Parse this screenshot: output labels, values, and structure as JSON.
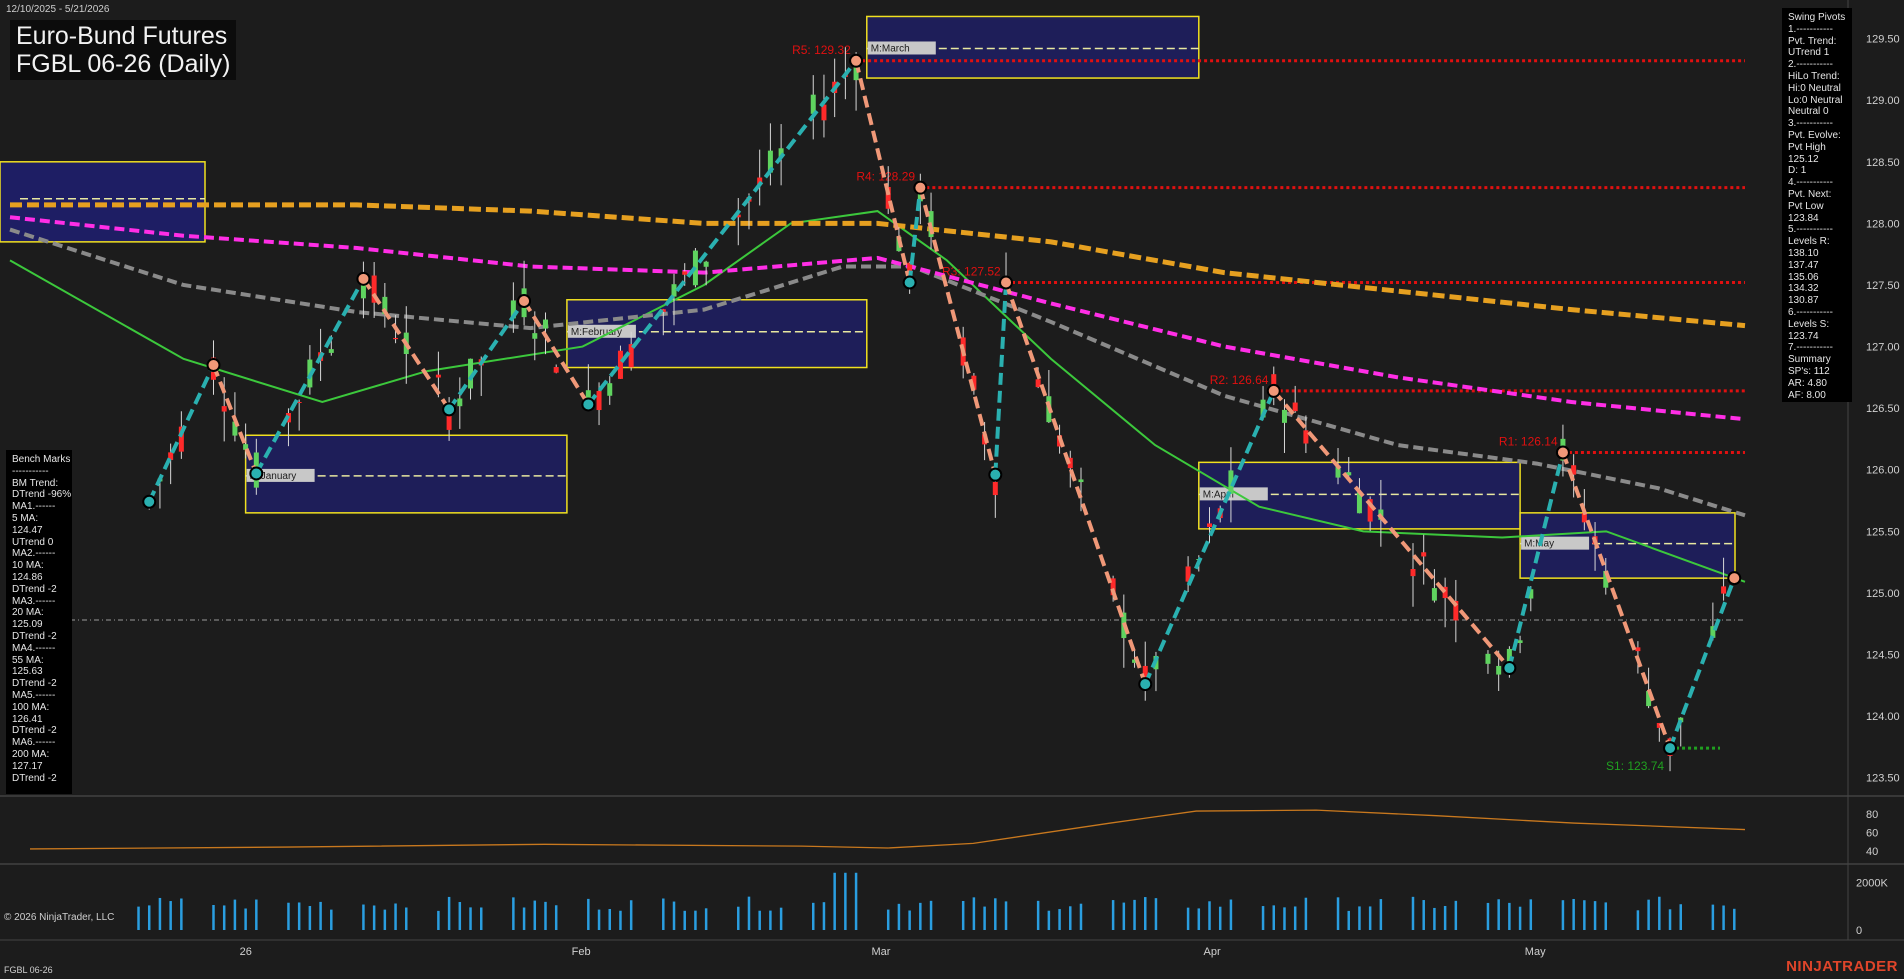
{
  "header": {
    "date_range": "12/10/2025 - 5/21/2026",
    "title_line1": "Euro-Bund Futures",
    "title_line2": "FGBL 06-26 (Daily)"
  },
  "footer": {
    "copyright": "© 2026 NinjaTrader, LLC",
    "symbol": "FGBL 06-26",
    "logo": "NINJATRADER"
  },
  "swing_pivots_panel": "Swing Pivots\n1.-----------\nPvt. Trend:\nUTrend 1\n2.-----------\nHiLo Trend:\nHi:0 Neutral\nLo:0 Neutral\nNeutral 0\n3.-----------\nPvt. Evolve:\nPvt High\n125.12\nD: 1\n4.-----------\nPvt. Next:\nPvt Low\n123.84\n5.-----------\nLevels R:\n138.10\n137.47\n135.06\n134.32\n130.87\n6.-----------\nLevels S:\n123.74\n7.-----------\nSummary\nSP's: 112\nAR: 4.80\nAF: 8.00",
  "bench_marks_panel": "Bench Marks\n-----------\nBM Trend:\nDTrend -96%\nMA1.------\n5 MA:\n124.47\nUTrend 0\nMA2.------\n10 MA:\n124.86\nDTrend -2\nMA3.------\n20 MA:\n125.09\nDTrend -2\nMA4.------\n55 MA:\n125.63\nDTrend -2\nMA5.------\n100 MA:\n126.41\nDTrend -2\nMA6.------\n200 MA:\n127.17\nDTrend -2",
  "colors": {
    "background": "#1c1c1c",
    "up_candle": "#5fd35f",
    "down_candle": "#ff2a2a",
    "ma_green": "#3cc83c",
    "ma_gray": "#8a8a8a",
    "ma_magenta": "#ff2ee6",
    "ma_orange": "#e6a020",
    "zone_fill": "#1e1e64",
    "zone_border": "#f0e020",
    "swing_up": "#2ab0b0",
    "swing_down": "#f09878",
    "resistance": "#e01010",
    "support": "#20a020"
  },
  "chart_data": {
    "type": "candlestick",
    "price_axis": {
      "range": [
        123.4,
        129.7
      ],
      "ticks": [
        "129.50",
        "129.00",
        "128.50",
        "128.00",
        "127.50",
        "127.00",
        "126.50",
        "126.00",
        "125.50",
        "125.00",
        "124.50",
        "124.00",
        "123.50"
      ],
      "last_price": 124.78
    },
    "x_ticks": [
      "26",
      "Feb",
      "Mar",
      "Apr",
      "May"
    ],
    "resistance_levels": [
      {
        "label": "R5: 129.32",
        "value": 129.32
      },
      {
        "label": "R4: 128.29",
        "value": 128.29
      },
      {
        "label": "R3: 127.52",
        "value": 127.52
      },
      {
        "label": "R2: 126.64",
        "value": 126.64
      },
      {
        "label": "R1: 126.14",
        "value": 126.14
      }
    ],
    "support_levels": [
      {
        "label": "S1: 123.74",
        "value": 123.74
      }
    ],
    "monthly_zones": [
      {
        "label": "M:January"
      },
      {
        "label": "M:February"
      },
      {
        "label": "M:March"
      },
      {
        "label": "M:April"
      },
      {
        "label": "M:May"
      }
    ],
    "swing_points": [
      {
        "date": "2025-12-23",
        "price": 125.74,
        "type": "low"
      },
      {
        "date": "2025-12-29",
        "price": 126.85,
        "type": "high"
      },
      {
        "date": "2026-01-02",
        "price": 125.97,
        "type": "low"
      },
      {
        "date": "2026-01-12",
        "price": 127.55,
        "type": "high"
      },
      {
        "date": "2026-01-20",
        "price": 126.49,
        "type": "low"
      },
      {
        "date": "2026-01-27",
        "price": 127.37,
        "type": "high"
      },
      {
        "date": "2026-02-02",
        "price": 126.53,
        "type": "low"
      },
      {
        "date": "2026-02-27",
        "price": 129.32,
        "type": "high"
      },
      {
        "date": "2026-03-04",
        "price": 127.52,
        "type": "low"
      },
      {
        "date": "2026-03-05",
        "price": 128.29,
        "type": "high"
      },
      {
        "date": "2026-03-12",
        "price": 125.96,
        "type": "low"
      },
      {
        "date": "2026-03-13",
        "price": 127.52,
        "type": "high"
      },
      {
        "date": "2026-03-26",
        "price": 124.26,
        "type": "low"
      },
      {
        "date": "2026-04-07",
        "price": 126.64,
        "type": "high"
      },
      {
        "date": "2026-04-29",
        "price": 124.39,
        "type": "low"
      },
      {
        "date": "2026-05-04",
        "price": 126.14,
        "type": "high"
      },
      {
        "date": "2026-05-14",
        "price": 123.74,
        "type": "low"
      },
      {
        "date": "2026-05-20",
        "price": 125.12,
        "type": "high"
      }
    ],
    "moving_averages": [
      {
        "name": "20 MA",
        "points": [
          [
            0,
            127.7
          ],
          [
            0.1,
            126.9
          ],
          [
            0.18,
            126.55
          ],
          [
            0.24,
            126.8
          ],
          [
            0.33,
            127.0
          ],
          [
            0.4,
            127.5
          ],
          [
            0.45,
            128.0
          ],
          [
            0.5,
            128.1
          ],
          [
            0.54,
            127.7
          ],
          [
            0.6,
            126.9
          ],
          [
            0.66,
            126.2
          ],
          [
            0.72,
            125.7
          ],
          [
            0.78,
            125.5
          ],
          [
            0.86,
            125.45
          ],
          [
            0.92,
            125.5
          ],
          [
            1.0,
            125.09
          ]
        ]
      },
      {
        "name": "55 MA",
        "points": [
          [
            0,
            127.95
          ],
          [
            0.1,
            127.5
          ],
          [
            0.2,
            127.28
          ],
          [
            0.3,
            127.15
          ],
          [
            0.4,
            127.3
          ],
          [
            0.48,
            127.65
          ],
          [
            0.52,
            127.65
          ],
          [
            0.6,
            127.2
          ],
          [
            0.7,
            126.6
          ],
          [
            0.8,
            126.2
          ],
          [
            0.88,
            126.05
          ],
          [
            0.95,
            125.85
          ],
          [
            1.0,
            125.63
          ]
        ]
      },
      {
        "name": "100 MA",
        "points": [
          [
            0,
            128.05
          ],
          [
            0.1,
            127.9
          ],
          [
            0.2,
            127.8
          ],
          [
            0.3,
            127.65
          ],
          [
            0.4,
            127.6
          ],
          [
            0.5,
            127.72
          ],
          [
            0.6,
            127.35
          ],
          [
            0.7,
            127.0
          ],
          [
            0.8,
            126.75
          ],
          [
            0.9,
            126.55
          ],
          [
            1.0,
            126.41
          ]
        ]
      },
      {
        "name": "200 MA",
        "points": [
          [
            0,
            128.15
          ],
          [
            0.1,
            128.15
          ],
          [
            0.2,
            128.15
          ],
          [
            0.3,
            128.1
          ],
          [
            0.4,
            128.0
          ],
          [
            0.5,
            128.0
          ],
          [
            0.6,
            127.85
          ],
          [
            0.7,
            127.6
          ],
          [
            0.8,
            127.45
          ],
          [
            0.9,
            127.3
          ],
          [
            1.0,
            127.17
          ]
        ]
      }
    ],
    "oscillator_panel": {
      "ticks": [
        "80",
        "60",
        "40"
      ],
      "range": [
        30,
        95
      ],
      "points": [
        [
          0,
          42
        ],
        [
          0.15,
          44
        ],
        [
          0.3,
          47
        ],
        [
          0.45,
          45
        ],
        [
          0.5,
          43
        ],
        [
          0.55,
          48
        ],
        [
          0.63,
          70
        ],
        [
          0.68,
          83
        ],
        [
          0.75,
          84
        ],
        [
          0.82,
          78
        ],
        [
          0.9,
          70
        ],
        [
          1.0,
          63
        ]
      ]
    },
    "volume_panel": {
      "ticks": [
        "2000K",
        "0"
      ],
      "max": 2600
    }
  }
}
